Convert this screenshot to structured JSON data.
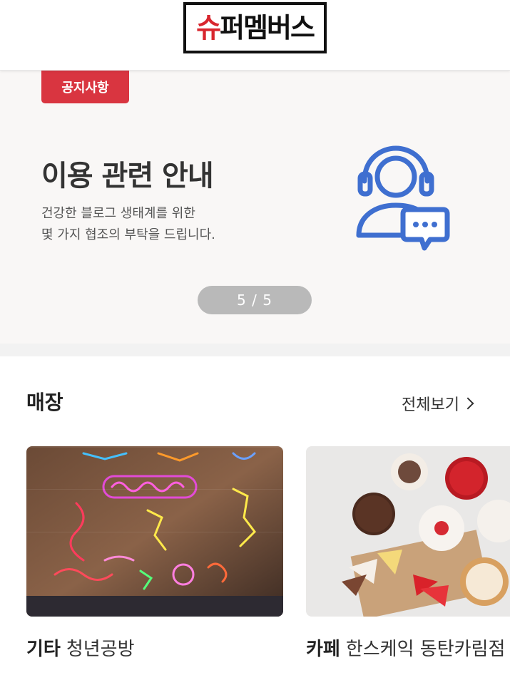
{
  "header": {
    "logo_text": "슈퍼멤버스",
    "logo_first_char": "슈",
    "logo_rest": "퍼멤버스"
  },
  "banner": {
    "badge": "공지사항",
    "title": "이용 관련 안내",
    "desc_line1": "건강한 블로그 생태계를 위한",
    "desc_line2": "몇 가지 협조의 부탁을 드립니다.",
    "icon": "customer-support-icon",
    "pager": "5 / 5"
  },
  "stores": {
    "section_title": "매장",
    "view_all": "전체보기",
    "items": [
      {
        "category": "기타",
        "name": "청년공방",
        "image": "neon-signs-photo"
      },
      {
        "category": "카페",
        "name": "한스케익 동탄카림점",
        "image": "cakes-photo"
      }
    ]
  },
  "colors": {
    "accent": "#d93540",
    "icon_blue": "#3f6fd0",
    "pager_bg": "#b9b9b9"
  }
}
